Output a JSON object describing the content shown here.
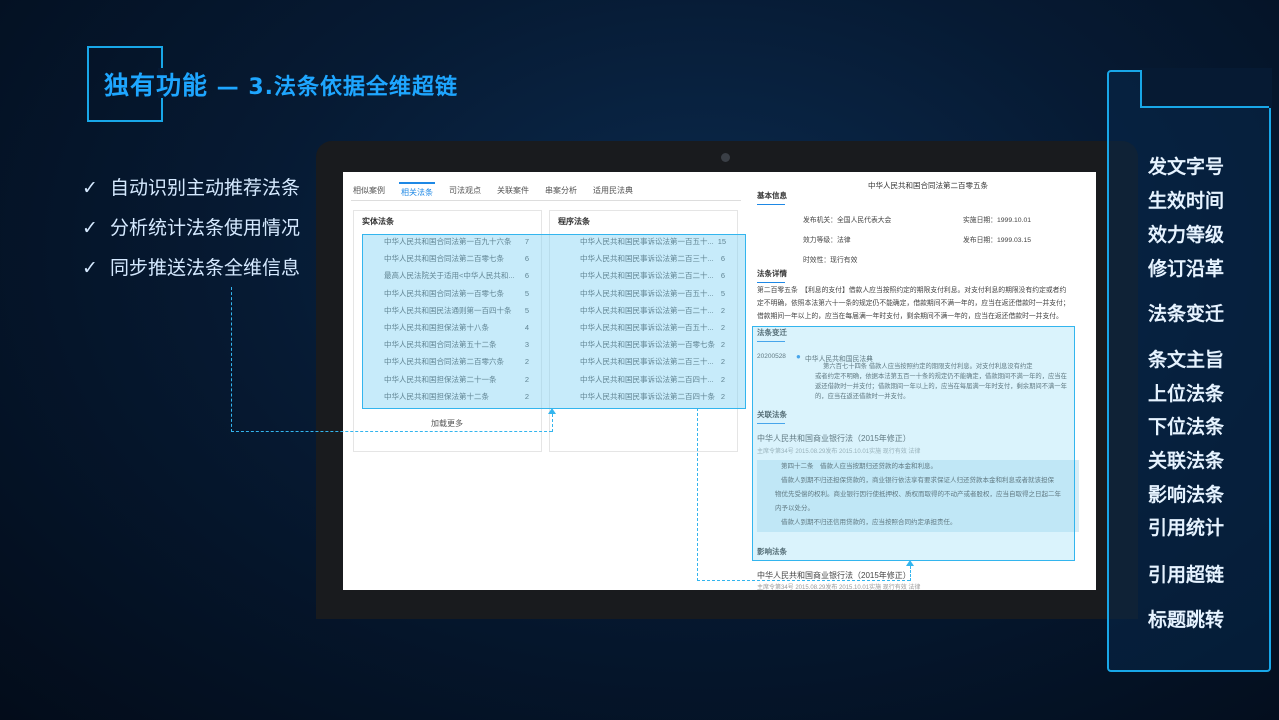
{
  "header": {
    "title_main": "独有功能",
    "title_sub": " — 3.法条依据全维超链"
  },
  "features": [
    "自动识别主动推荐法条",
    "分析统计法条使用情况",
    "同步推送法条全维信息"
  ],
  "checkmark": "✓",
  "app": {
    "tabs": [
      "相似案例",
      "相关法条",
      "司法观点",
      "关联案件",
      "串案分析",
      "适用民法典"
    ],
    "active_tab": "相关法条",
    "left_col": {
      "header": "实体法条",
      "rows": [
        {
          "name": "中华人民共和国合同法第一百九十六条",
          "count": "7"
        },
        {
          "name": "中华人民共和国合同法第二百零七条",
          "count": "6"
        },
        {
          "name": "最高人民法院关于适用<中华人民共和...",
          "count": "6"
        },
        {
          "name": "中华人民共和国合同法第一百零七条",
          "count": "5"
        },
        {
          "name": "中华人民共和国民法通则第一百四十条",
          "count": "5"
        },
        {
          "name": "中华人民共和国担保法第十八条",
          "count": "4"
        },
        {
          "name": "中华人民共和国合同法第五十二条",
          "count": "3"
        },
        {
          "name": "中华人民共和国合同法第二百零六条",
          "count": "2"
        },
        {
          "name": "中华人民共和国担保法第二十一条",
          "count": "2"
        },
        {
          "name": "中华人民共和国担保法第十二条",
          "count": "2"
        }
      ]
    },
    "right_col": {
      "header": "程序法条",
      "rows": [
        {
          "name": "中华人民共和国民事诉讼法第一百五十...",
          "count": "15"
        },
        {
          "name": "中华人民共和国民事诉讼法第二百三十...",
          "count": "6"
        },
        {
          "name": "中华人民共和国民事诉讼法第二百二十...",
          "count": "6"
        },
        {
          "name": "中华人民共和国民事诉讼法第一百五十...",
          "count": "5"
        },
        {
          "name": "中华人民共和国民事诉讼法第一百二十...",
          "count": "2"
        },
        {
          "name": "中华人民共和国民事诉讼法第一百五十...",
          "count": "2"
        },
        {
          "name": "中华人民共和国民事诉讼法第一百零七条",
          "count": "2"
        },
        {
          "name": "中华人民共和国民事诉讼法第二百三十...",
          "count": "2"
        },
        {
          "name": "中华人民共和国民事诉讼法第二百四十...",
          "count": "2"
        },
        {
          "name": "中华人民共和国民事诉讼法第二百四十条",
          "count": "2"
        }
      ]
    },
    "load_more": "加载更多",
    "detail": {
      "law_title": "中华人民共和国合同法第二百零五条",
      "basic_info": "基本信息",
      "issuer": "发布机关：全国人民代表大会",
      "impl_date": "实施日期：1999.10.01",
      "level": "效力等级：法律",
      "pub_date": "发布日期：1999.03.15",
      "validity": "时效性：现行有效",
      "law_detail": "法条详情",
      "detail_lines": [
        "第二百零五条　【利息的支付】借款人应当按照约定的期限支付利息。对支付利息的期限没有约定或者约",
        "定不明确，依照本法第六十一条的规定仍不能确定，借款期间不满一年的，应当在返还借款时一并支付；",
        "借款期间一年以上的，应当在每届满一年时支付，剩余期间不满一年的，应当在返还借款时一并支付。"
      ],
      "change": "法条变迁",
      "change_date": "20200528",
      "change_law": "中华人民共和国民法典",
      "change_lines": [
        "第六百七十四条 借款人应当按照约定的期限支付利息。对支付利息没有约定",
        "或者约定不明确，依据本法第五百一十条的规定仍不能确定，借款期间不满一年的，应当在",
        "返还借款时一并支付；借款期间一年以上的，应当在每届满一年时支付，剩余期间不满一年",
        "的，应当在返还借款时一并支付。"
      ],
      "related": "关联法条",
      "related_title": "中华人民共和国商业银行法（2015年修正）",
      "related_meta": "主席令第34号 2015.08.29发布 2015.10.01实施 现行有效 法律",
      "related_lines": [
        "第四十二条　借款人应当按期归还贷款的本金和利息。",
        "借款人到期不归还担保贷款的，商业银行依法享有要求保证人归还贷款本金和利息或者就该担保",
        "物优先受偿的权利。商业银行因行使抵押权、质权而取得的不动产或者股权，应当自取得之日起二年",
        "内予以处分。",
        "借款人到期不归还信用贷款的，应当按照合同约定承担责任。"
      ],
      "influence": "影响法条",
      "influence_title": "中华人民共和国商业银行法（2015年修正）",
      "influence_meta": "主席令第34号 2015.08.29发布 2015.10.01实施 现行有效 法律"
    }
  },
  "side_items": [
    "发文字号",
    "生效时间",
    "效力等级",
    "修订沿革",
    "法条变迁",
    "条文主旨",
    "上位法条",
    "下位法条",
    "关联法条",
    "影响法条",
    "引用统计",
    "引用超链",
    "标题跳转"
  ]
}
